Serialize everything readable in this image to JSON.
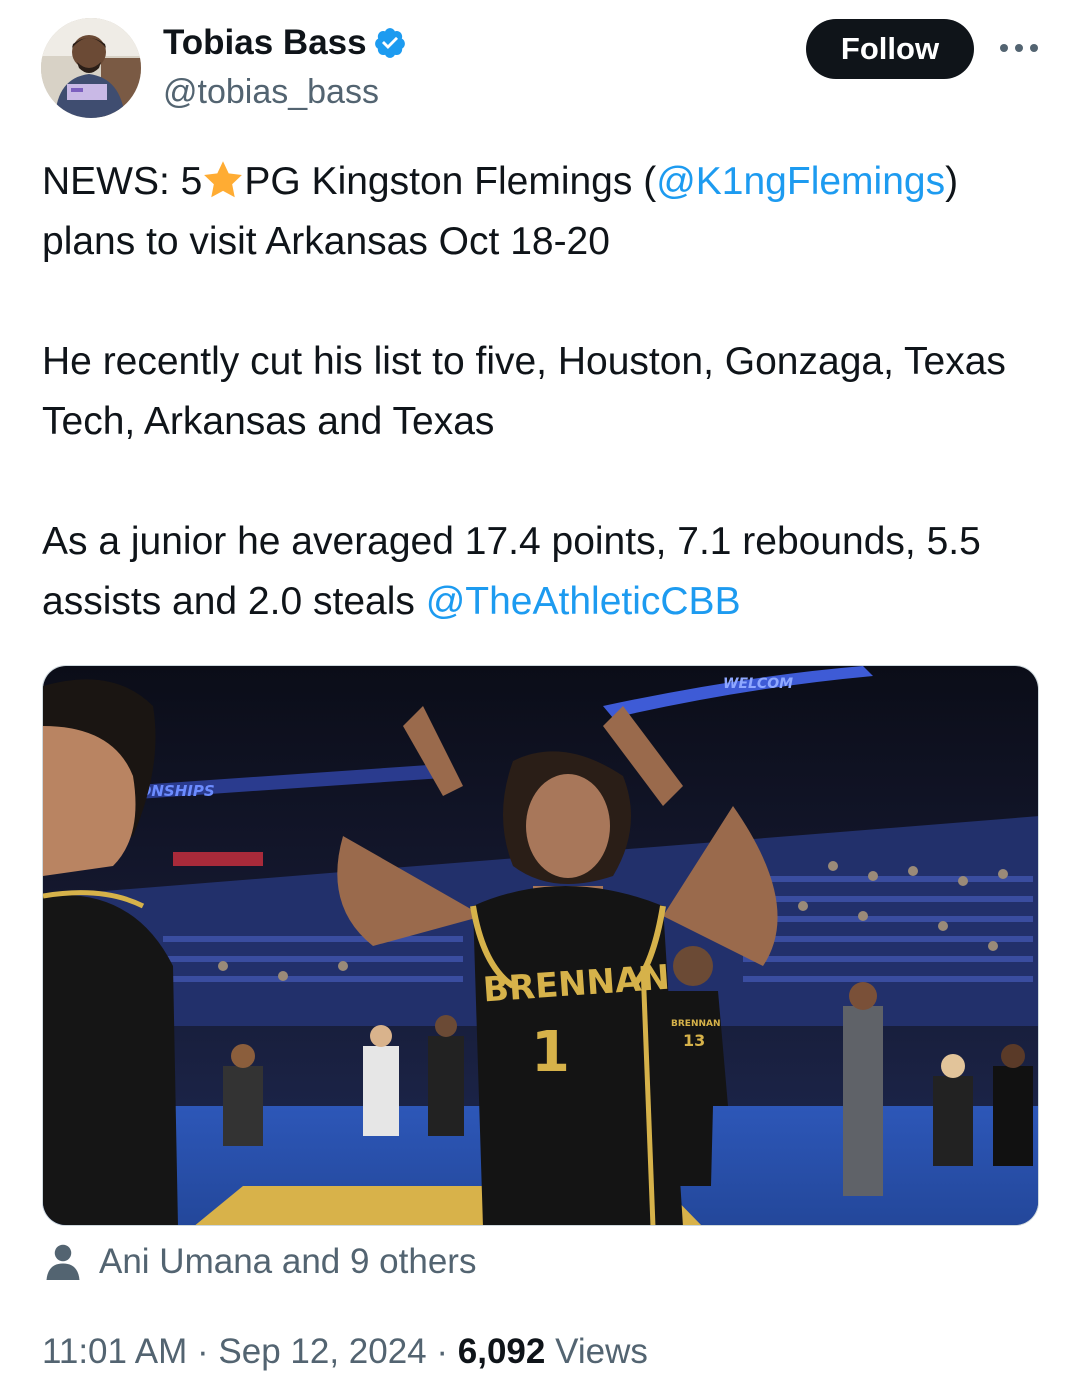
{
  "author": {
    "display_name": "Tobias Bass",
    "handle": "@tobias_bass",
    "verified": true,
    "avatar_icon": "profile-photo"
  },
  "follow_label": "Follow",
  "more_icon": "ellipsis-icon",
  "tweet": {
    "line1_prefix": "NEWS: 5",
    "line1_star": "star-emoji",
    "line1_mid": "PG Kingston Flemings (",
    "mention1": "@K1ngFlemings",
    "line1_suffix": ")",
    "line2": "plans to visit Arkansas Oct 18-20",
    "para2": "He recently cut his list to five, Houston, Gonzaga, Texas Tech, Arkansas and Texas",
    "para3_prefix": "As a junior he averaged 17.4 points, 7.1 rebounds, 5.5 assists and 2.0 steals ",
    "mention2": "@TheAthleticCBB"
  },
  "media": {
    "jersey_text": "BRENNAN",
    "jersey_number": "1",
    "banner_text": "IONSHIPS",
    "top_banner_text": "WELCOM",
    "jersey13_text": "BRENNAN",
    "jersey13_number": "13"
  },
  "social_context": "Ani Umana and 9 others",
  "meta": {
    "time": "11:01 AM",
    "separator": "·",
    "date": "Sep 12, 2024",
    "views_count": "6,092",
    "views_label": "Views"
  },
  "colors": {
    "accent": "#1d9bf0",
    "text": "#0f1419",
    "secondary": "#536471"
  }
}
